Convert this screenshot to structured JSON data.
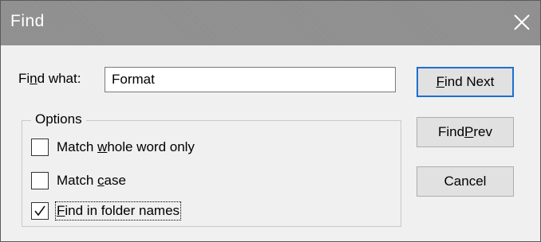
{
  "window": {
    "title": "Find",
    "close_icon": "close-icon"
  },
  "find": {
    "label_pre": "Fi",
    "label_mnemonic": "n",
    "label_post": "d what:",
    "value": "Format"
  },
  "options": {
    "legend": "Options",
    "items": [
      {
        "pre": "Match ",
        "mnemonic": "w",
        "post": "hole word only",
        "checked": false
      },
      {
        "pre": "Match ",
        "mnemonic": "c",
        "post": "ase",
        "checked": false
      },
      {
        "pre": "",
        "mnemonic": "F",
        "post": "ind in folder names",
        "checked": true
      }
    ]
  },
  "buttons": {
    "find_next": {
      "mnemonic": "F",
      "post": "ind Next"
    },
    "find_prev": {
      "pre": "Find ",
      "mnemonic": "P",
      "post": "rev"
    },
    "cancel": {
      "label": "Cancel"
    }
  },
  "colors": {
    "titlebar": "#8e8e8e",
    "default_button_border": "#1e6fd0",
    "dialog_bg": "#f0f0f0"
  }
}
